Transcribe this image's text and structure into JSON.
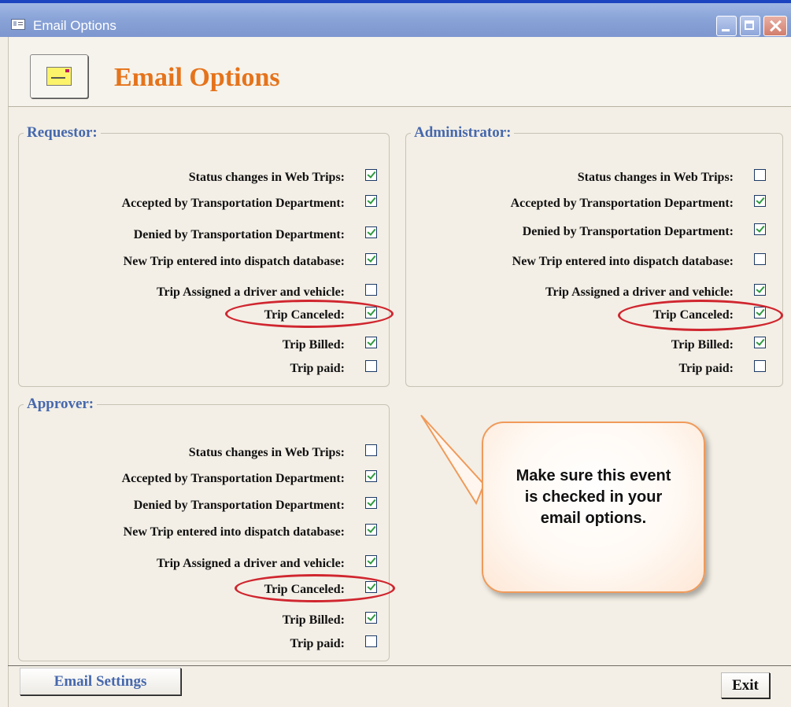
{
  "window": {
    "title": "Email Options"
  },
  "header": {
    "title": "Email Options",
    "icon": "envelope-icon"
  },
  "requestor": {
    "title": "Requestor:",
    "items": [
      {
        "label": "Status changes in Web Trips:",
        "checked": true
      },
      {
        "label": "Accepted  by Transportation Department:",
        "checked": true
      },
      {
        "label": "Denied by Transportation Department:",
        "checked": true
      },
      {
        "label": "New Trip entered into dispatch database:",
        "checked": true
      },
      {
        "label": "Trip Assigned a driver and vehicle:",
        "checked": false
      },
      {
        "label": "Trip Canceled:",
        "checked": true
      },
      {
        "label": "Trip Billed:",
        "checked": true
      },
      {
        "label": "Trip paid:",
        "checked": false
      }
    ]
  },
  "administrator": {
    "title": "Administrator:",
    "items": [
      {
        "label": "Status changes in Web Trips:",
        "checked": false
      },
      {
        "label": "Accepted  by Transportation Department:",
        "checked": true
      },
      {
        "label": "Denied by Transportation Department:",
        "checked": true
      },
      {
        "label": "New Trip entered into dispatch database:",
        "checked": false
      },
      {
        "label": "Trip Assigned a driver and vehicle:",
        "checked": true
      },
      {
        "label": "Trip Canceled:",
        "checked": true
      },
      {
        "label": "Trip Billed:",
        "checked": true
      },
      {
        "label": "Trip paid:",
        "checked": false
      }
    ]
  },
  "approver": {
    "title": "Approver:",
    "items": [
      {
        "label": "Status changes in Web Trips:",
        "checked": false
      },
      {
        "label": "Accepted by Transportation Department:",
        "checked": true
      },
      {
        "label": "Denied by Transportation Department:",
        "checked": true
      },
      {
        "label": "New Trip entered into dispatch database:",
        "checked": true
      },
      {
        "label": "Trip Assigned a driver and vehicle:",
        "checked": true
      },
      {
        "label": "Trip Canceled:",
        "checked": true
      },
      {
        "label": "Trip Billed:",
        "checked": true
      },
      {
        "label": "Trip paid:",
        "checked": false
      }
    ]
  },
  "callout": {
    "text": "Make sure this event is checked in your email options."
  },
  "buttons": {
    "email_settings": "Email Settings",
    "exit": "Exit"
  },
  "colors": {
    "title_orange": "#e5731b",
    "group_title_blue": "#4668ad",
    "highlight_red": "#d0262f",
    "callout_border": "#f09a5a"
  }
}
